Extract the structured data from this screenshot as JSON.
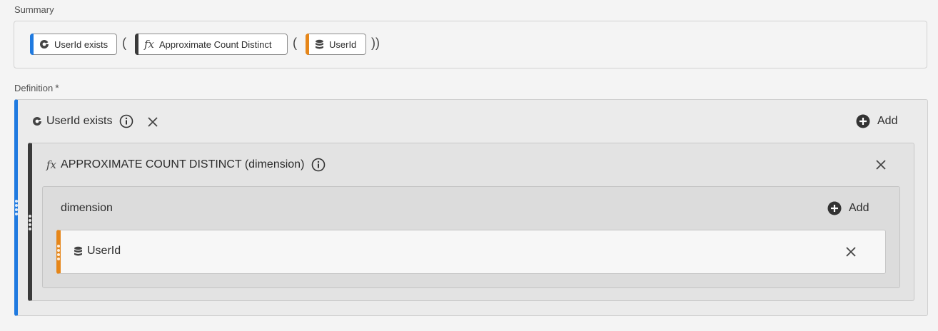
{
  "summary": {
    "label": "Summary",
    "tokens": [
      {
        "label": "UserId exists",
        "icon": "segment-icon",
        "color": "#1f7ae0"
      },
      {
        "label": "Approximate Count Distinct",
        "icon": "function-icon",
        "color": "#3a3a3a"
      },
      {
        "label": "UserId",
        "icon": "dimension-icon",
        "color": "#e68619"
      }
    ],
    "open_paren": "(",
    "close_parens": "))"
  },
  "definition": {
    "label": "Definition",
    "required_mark": "*",
    "segment": {
      "title": "UserId exists",
      "add_label": "Add"
    },
    "function": {
      "title": "APPROXIMATE COUNT DISTINCT (dimension)",
      "fx": "fx"
    },
    "dimension": {
      "title": "dimension",
      "add_label": "Add"
    },
    "item": {
      "title": "UserId"
    }
  }
}
